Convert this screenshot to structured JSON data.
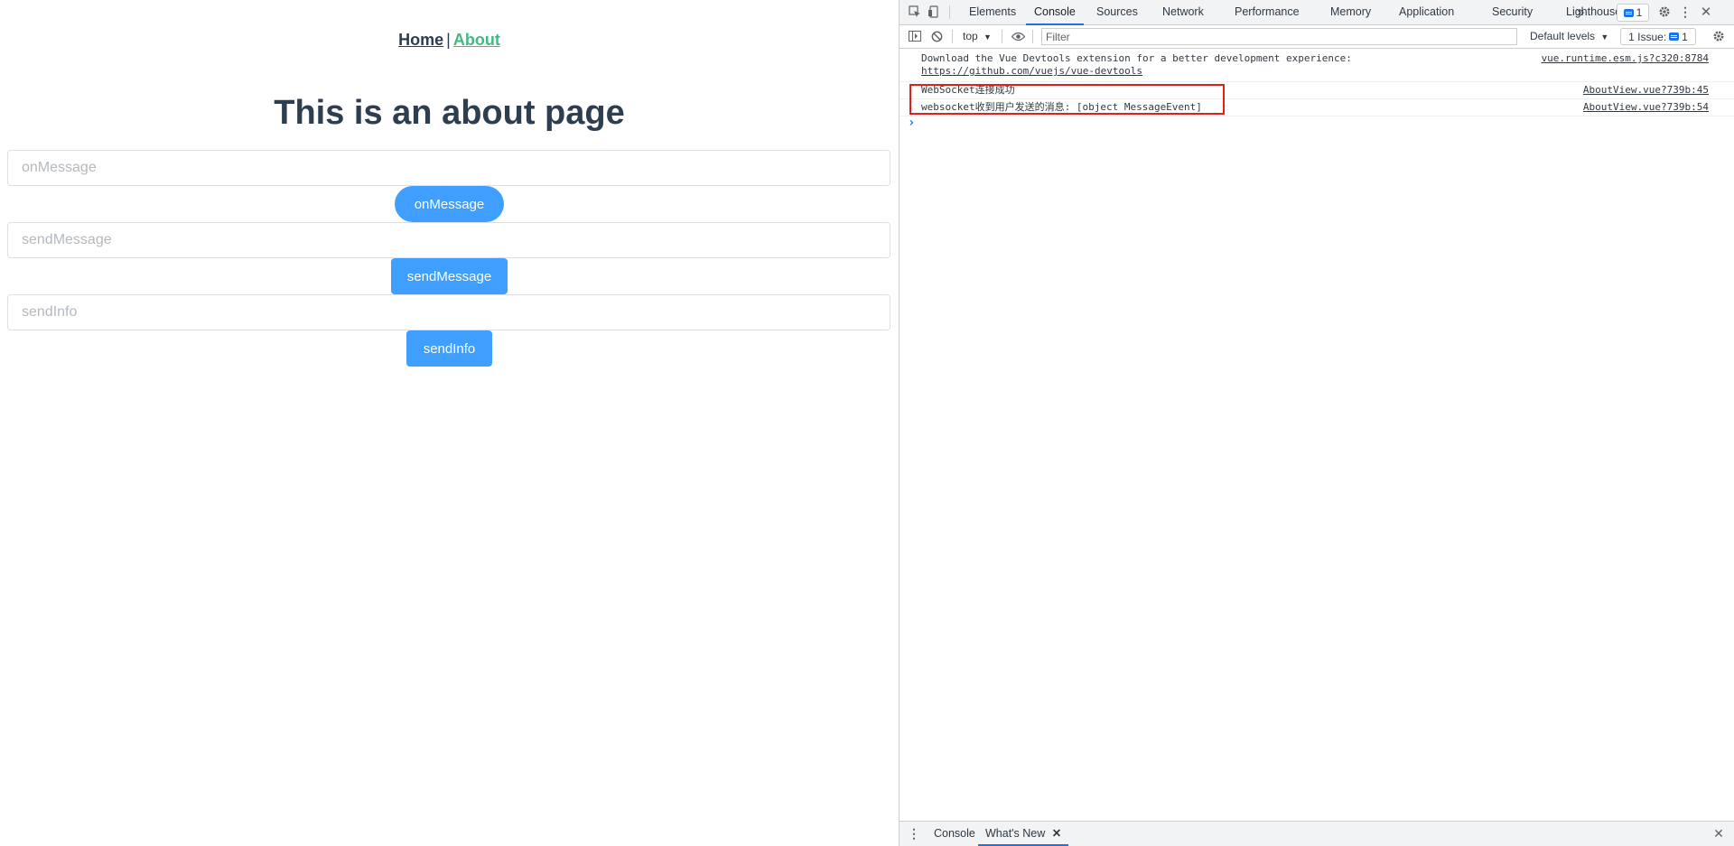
{
  "app": {
    "nav": {
      "home": "Home",
      "separator": "|",
      "about": "About"
    },
    "title": "This is an about page",
    "forms": [
      {
        "placeholder": "onMessage",
        "button": "onMessage"
      },
      {
        "placeholder": "sendMessage",
        "button": "sendMessage"
      },
      {
        "placeholder": "sendInfo",
        "button": "sendInfo"
      }
    ]
  },
  "devtools": {
    "tabs": [
      "Elements",
      "Console",
      "Sources",
      "Network",
      "Performance",
      "Memory",
      "Application",
      "Security",
      "Lighthouse"
    ],
    "active_tab": "Console",
    "more_tabs_glyph": "»",
    "issues_badge_count": "1",
    "toolbar": {
      "context": "top",
      "filter_placeholder": "Filter",
      "levels": "Default levels",
      "issues_label": "1 Issue:",
      "issues_count": "1"
    },
    "console": [
      {
        "text": "Download the Vue Devtools extension for a better development experience:",
        "link": "https://github.com/vuejs/vue-devtools",
        "source": "vue.runtime.esm.js?c320:8784"
      },
      {
        "text": "WebSocket连接成功",
        "source": "AboutView.vue?739b:45"
      },
      {
        "text": "websocket收到用户发送的消息: [object MessageEvent]",
        "source": "AboutView.vue?739b:54"
      }
    ],
    "drawer": {
      "tabs": [
        "Console",
        "What's New"
      ],
      "active": "What's New"
    }
  },
  "colors": {
    "primary_button": "#409eff",
    "vue_green": "#42b983",
    "heading": "#2c3e50",
    "highlight_box": "#e0201b",
    "devtools_accent": "#1a73e8"
  }
}
